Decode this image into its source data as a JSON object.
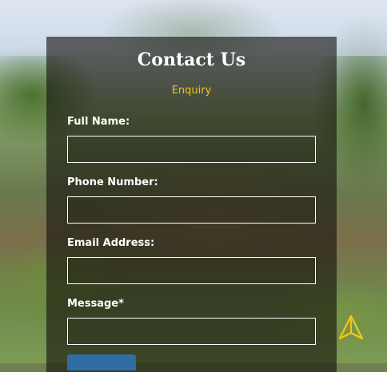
{
  "form": {
    "title": "Contact Us",
    "subtitle": "Enquiry",
    "fields": [
      {
        "label": "Full Name:",
        "value": "",
        "placeholder": ""
      },
      {
        "label": "Phone Number:",
        "value": "",
        "placeholder": ""
      },
      {
        "label": "Email Address:",
        "value": "",
        "placeholder": ""
      },
      {
        "label": "Message*",
        "value": "",
        "placeholder": ""
      }
    ],
    "submit_label": ""
  },
  "colors": {
    "accent": "#f0c419",
    "submit": "#2f6ea5",
    "overlay": "rgba(20,18,12,0.62)"
  },
  "icons": {
    "floating": "navigation-arrow-icon"
  }
}
